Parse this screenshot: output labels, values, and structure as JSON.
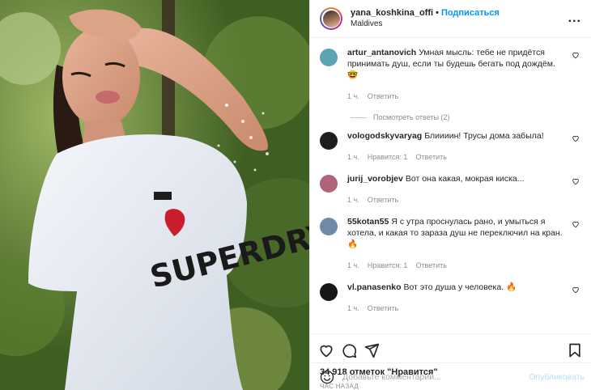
{
  "header": {
    "username": "yana_koshkina_offi",
    "separator": "•",
    "follow_label": "Подписаться",
    "location": "Maldives",
    "more_label": "..."
  },
  "comments": [
    {
      "user": "artur_antanovich",
      "text": "Умная мысль: тебе не придётся принимать душ, если ты будешь бегать под дождём. 🤓",
      "time": "1 ч.",
      "likes": "",
      "reply_label": "Ответить",
      "avatar_color": "#5ba4b3"
    },
    {
      "user": "vologodskyvaryag",
      "text": "Блиииин! Трусы дома забыла!",
      "time": "1 ч.",
      "likes": "Нравится: 1",
      "reply_label": "Ответить",
      "avatar_color": "#1e1e1e"
    },
    {
      "user": "jurij_vorobjev",
      "text": "Вот она какая, мокрая киска...",
      "time": "1 ч.",
      "likes": "",
      "reply_label": "Ответить",
      "avatar_color": "#b0647a"
    },
    {
      "user": "55kotan55",
      "text": "Я с утра проснулась рано, и умыться я хотела, и какая то зараза душ не переключил на кран. 🔥",
      "time": "1 ч.",
      "likes": "Нравится: 1",
      "reply_label": "Ответить",
      "avatar_color": "#6f8aa8"
    },
    {
      "user": "vl.panasenko",
      "text": "Вот это душа у человека. 🔥",
      "time": "1 ч.",
      "likes": "",
      "reply_label": "Ответить",
      "avatar_color": "#161616"
    }
  ],
  "view_replies_label": "Посмотреть ответы (2)",
  "likes_text": "34 918 отметок \"Нравится\"",
  "time_ago": "ЧАС НАЗАД",
  "add_comment": {
    "placeholder": "Добавьте комментарий...",
    "publish_label": "Опубликовать"
  },
  "photo": {
    "shirt_text": "SUPERDRY"
  },
  "colors": {
    "accent": "#0095f6",
    "muted": "#8e8e8e",
    "text": "#262626"
  }
}
